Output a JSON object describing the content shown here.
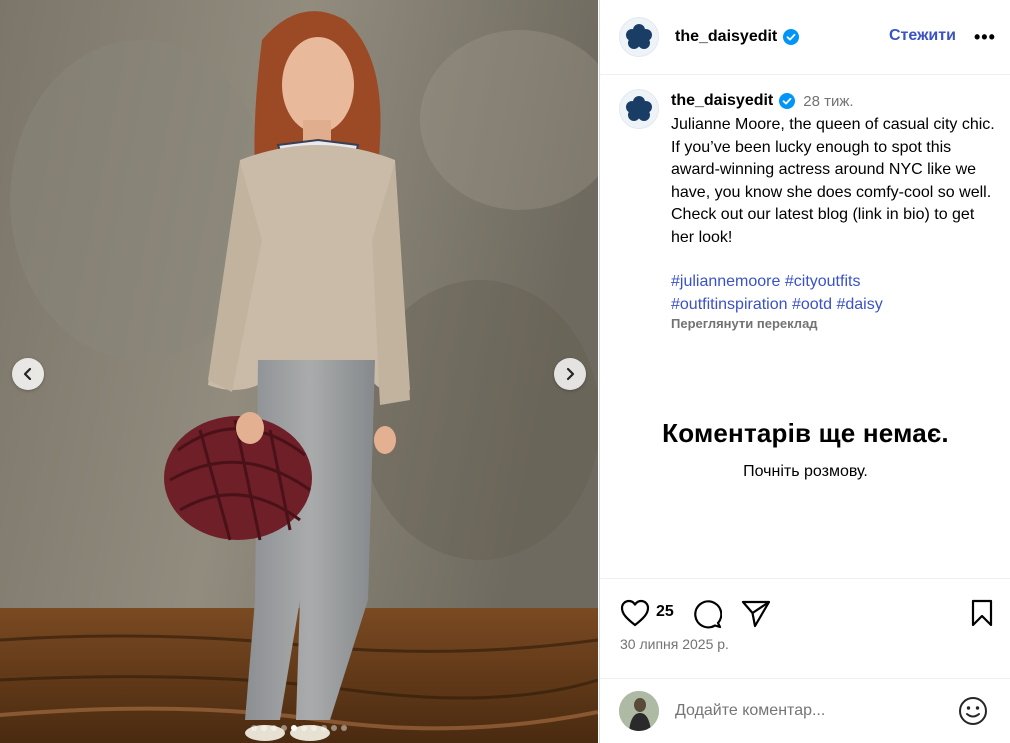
{
  "post": {
    "username": "the_daisyedit",
    "follow_label": "Стежити",
    "more_label": "•••",
    "time_ago": "28 тиж.",
    "caption": "Julianne Moore, the queen of casual city chic. If you’ve been lucky enough to spot this award-winning actress around NYC like we have, you know she does comfy-cool so well. Check out our latest blog (link in bio) to get her look!",
    "hashtags": [
      "#juliannemoore",
      "#cityoutfits",
      "#outfitinspiration",
      "#ootd",
      "#daisy"
    ],
    "translate_label": "Переглянути переклад"
  },
  "comments": {
    "empty_title": "Коментарів ще немає.",
    "empty_subtitle": "Почніть розмову."
  },
  "actions": {
    "likes": "25",
    "date": "30 липня 2025 р."
  },
  "comment_box": {
    "placeholder": "Додайте коментар..."
  },
  "carousel": {
    "slide_count": 10,
    "active_index": 4
  },
  "colors": {
    "link": "#3a52c8",
    "verified": "#0095f6",
    "logo": "#1a3d66"
  }
}
